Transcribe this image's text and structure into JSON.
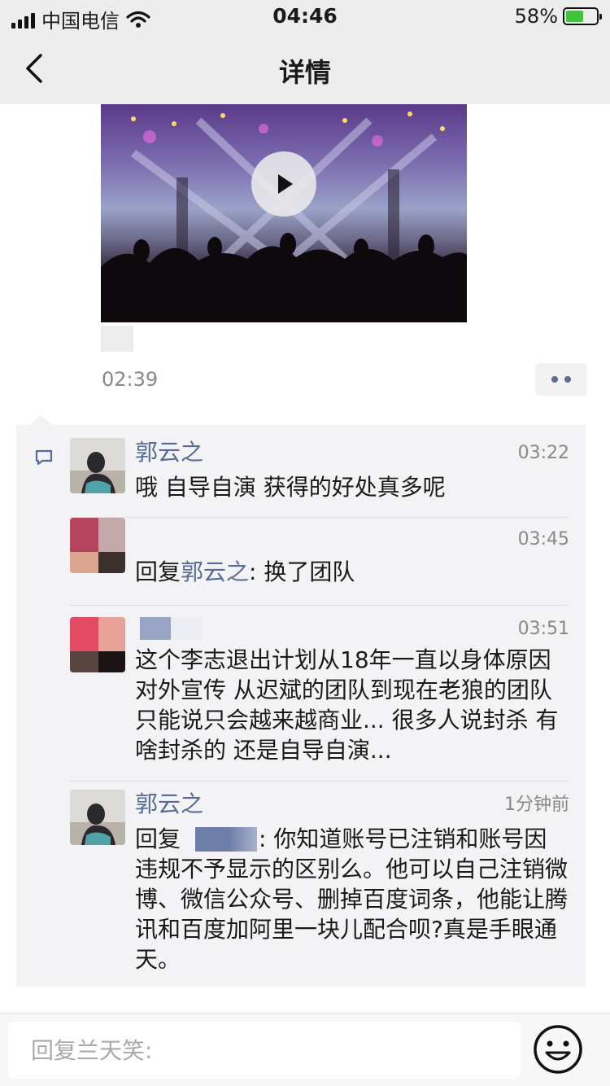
{
  "status": {
    "carrier": "中国电信",
    "time": "04:46",
    "battery": "58%",
    "battery_level": 0.58
  },
  "nav": {
    "title": "详情"
  },
  "post": {
    "time": "02:39"
  },
  "comments": [
    {
      "name": "郭云之",
      "time": "03:22",
      "text": "哦 自导自演 获得的好处真多呢"
    },
    {
      "name": "",
      "time": "03:45",
      "reply_prefix": "回复",
      "reply_target": "郭云之",
      "text": ": 换了团队"
    },
    {
      "name": "",
      "time": "03:51",
      "text": "这个李志退出计划从18年一直以身体原因对外宣传 从迟斌的团队到现在老狼的团队 只能说只会越来越商业... 很多人说封杀 有啥封杀的 还是自导自演..."
    },
    {
      "name": "郭云之",
      "time": "1分钟前",
      "reply_prefix": "回复",
      "text": ": 你知道账号已注销和账号因违规不予显示的区别么。他可以自己注销微博、微信公众号、删掉百度词条，他能让腾讯和百度加阿里一块儿配合呗?真是手眼通天。"
    }
  ],
  "input": {
    "placeholder": "回复兰天笑:"
  },
  "colors": {
    "link": "#576b95",
    "panel": "#f3f3f5",
    "header": "#ededed"
  }
}
